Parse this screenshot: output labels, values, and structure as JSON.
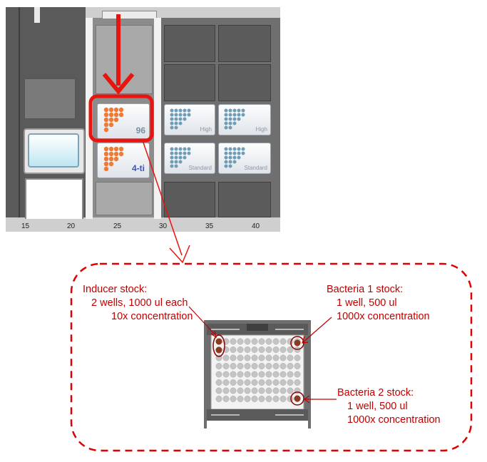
{
  "deck": {
    "axis_ticks": [
      "15",
      "20",
      "25",
      "30",
      "35",
      "40"
    ],
    "plates": {
      "plate_96_label": "96",
      "plate_4ti_label": "4-ti",
      "tip_high_1": "High",
      "tip_high_2": "High",
      "tip_standard_1": "Standard",
      "tip_standard_2": "Standard"
    },
    "colors": {
      "orange_well": "#ef7a36",
      "blue_well": "#6f9db5",
      "highlight": "#e8140f"
    }
  },
  "callout": {
    "inducer": {
      "title": "Inducer stock:",
      "line1": "2 wells, 1000 ul each",
      "line2": "10x concentration"
    },
    "bacteria1": {
      "title": "Bacteria 1 stock:",
      "line1": "1 well, 500 ul",
      "line2": "1000x concentration"
    },
    "bacteria2": {
      "title": "Bacteria 2 stock:",
      "line1": "1 well, 500 ul",
      "line2": "1000x concentration"
    },
    "colors": {
      "text": "#c00000",
      "dash": "#e00000",
      "stock_well": "#8b3a1f"
    }
  }
}
